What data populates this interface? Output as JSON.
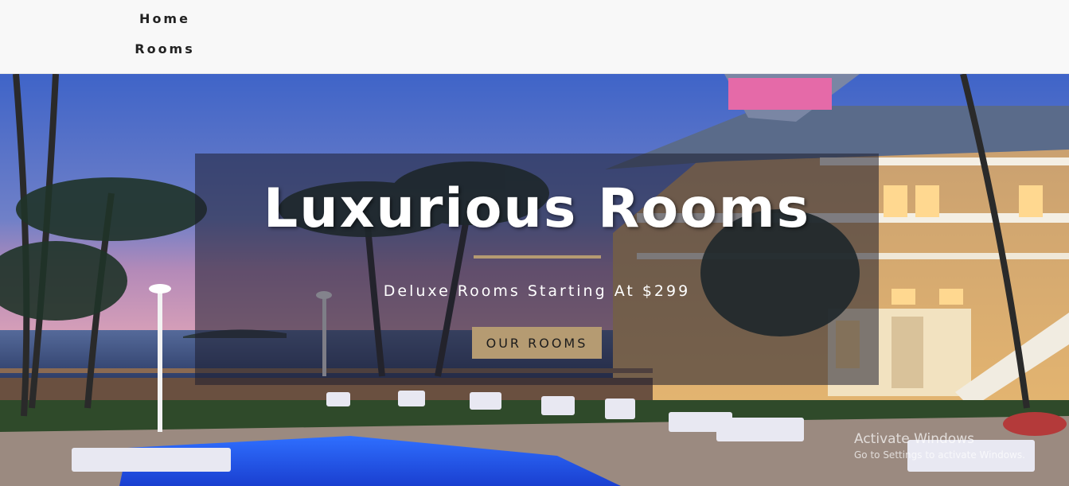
{
  "nav": {
    "items": [
      {
        "label": "Home"
      },
      {
        "label": "Rooms"
      }
    ]
  },
  "hero": {
    "title": "Luxurious Rooms",
    "subtitle": "Deluxe Rooms Starting At $299",
    "cta_label": "OUR ROOMS",
    "accent_color": "#b59b72"
  },
  "watermark": {
    "title": "Activate Windows",
    "subtitle": "Go to Settings to activate Windows."
  }
}
